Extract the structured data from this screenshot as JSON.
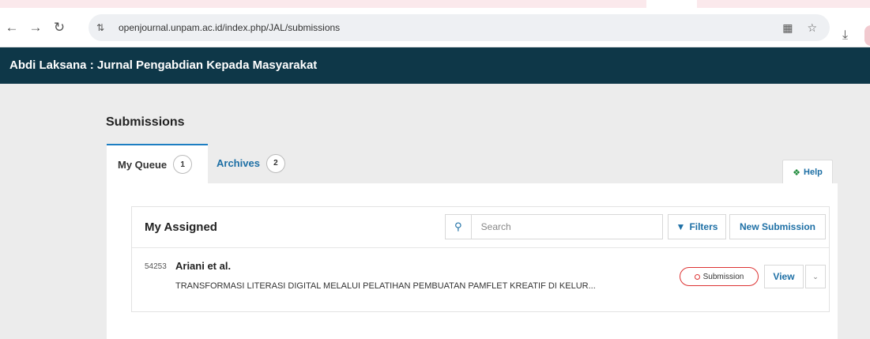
{
  "browser": {
    "url": "openjournal.unpam.ac.id/index.php/JAL/submissions",
    "icons": [
      "back-icon",
      "forward-icon",
      "reload-icon",
      "site-settings-icon",
      "translate-icon",
      "star-icon",
      "download-icon"
    ]
  },
  "site": {
    "title": "Abdi Laksana : Jurnal Pengabdian Kepada Masyarakat",
    "header_color": "#0e3748"
  },
  "page": {
    "title": "Submissions",
    "tabs": [
      {
        "label": "My Queue",
        "count": "1"
      },
      {
        "label": "Archives",
        "count": "2"
      }
    ],
    "help_label": "Help"
  },
  "list": {
    "title": "My Assigned",
    "search_placeholder": "Search",
    "filters_label": "Filters",
    "new_submission_label": "New Submission",
    "items": [
      {
        "id": "54253",
        "author": "Ariani et al.",
        "title": "TRANSFORMASI LITERASI DIGITAL MELALUI PELATIHAN PEMBUATAN PAMFLET KREATIF DI KELUR...",
        "stage": "Submission",
        "view_label": "View"
      }
    ]
  },
  "colors": {
    "accent": "#1d6fa5",
    "active_tab_border": "#1d7ec2",
    "stage_badge": "#dd3333",
    "help_icon": "#1e8a3a"
  }
}
